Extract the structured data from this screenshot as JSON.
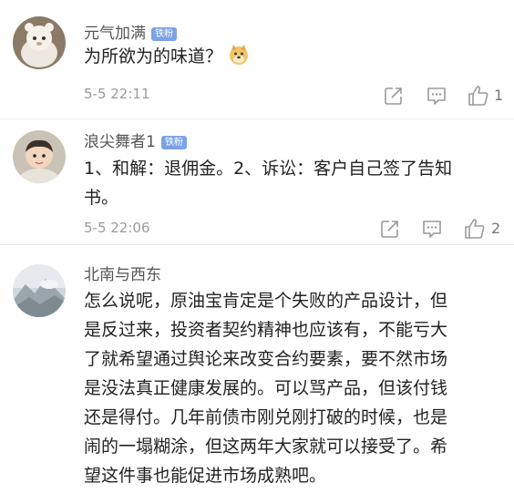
{
  "comments": [
    {
      "username": "元气加满",
      "badge": "铁粉",
      "text": "为所欲为的味道？",
      "emoji": "doge-emoji",
      "time": "5-5 22:11",
      "likes": "1"
    },
    {
      "username": "浪尖舞者1",
      "badge": "铁粉",
      "lines": [
        "1、和解：退佣金。2、诉讼：客户自己签了告知",
        "书。"
      ],
      "time": "5-5 22:06",
      "likes": "2"
    },
    {
      "username": "北南与西东",
      "lines": [
        "怎么说呢，原油宝肯定是个失败的产品设计，但",
        "是反过来，投资者契约精神也应该有，不能亏大",
        "了就希望通过舆论来改变合约要素，要不然市场",
        "是没法真正健康发展的。可以骂产品，但该付钱",
        "还是得付。几年前债市刚兑刚打破的时候，也是",
        "闹的一塌糊涂，但这两年大家就可以接受了。希",
        "望这件事也能促进市场成熟吧。"
      ]
    }
  ],
  "icons": {
    "share": "share-icon",
    "comment": "comment-icon",
    "like": "like-icon"
  },
  "colors": {
    "badge": "#7aa2e6",
    "meta": "#9b9b9b",
    "text": "#222222",
    "username": "#555555"
  }
}
